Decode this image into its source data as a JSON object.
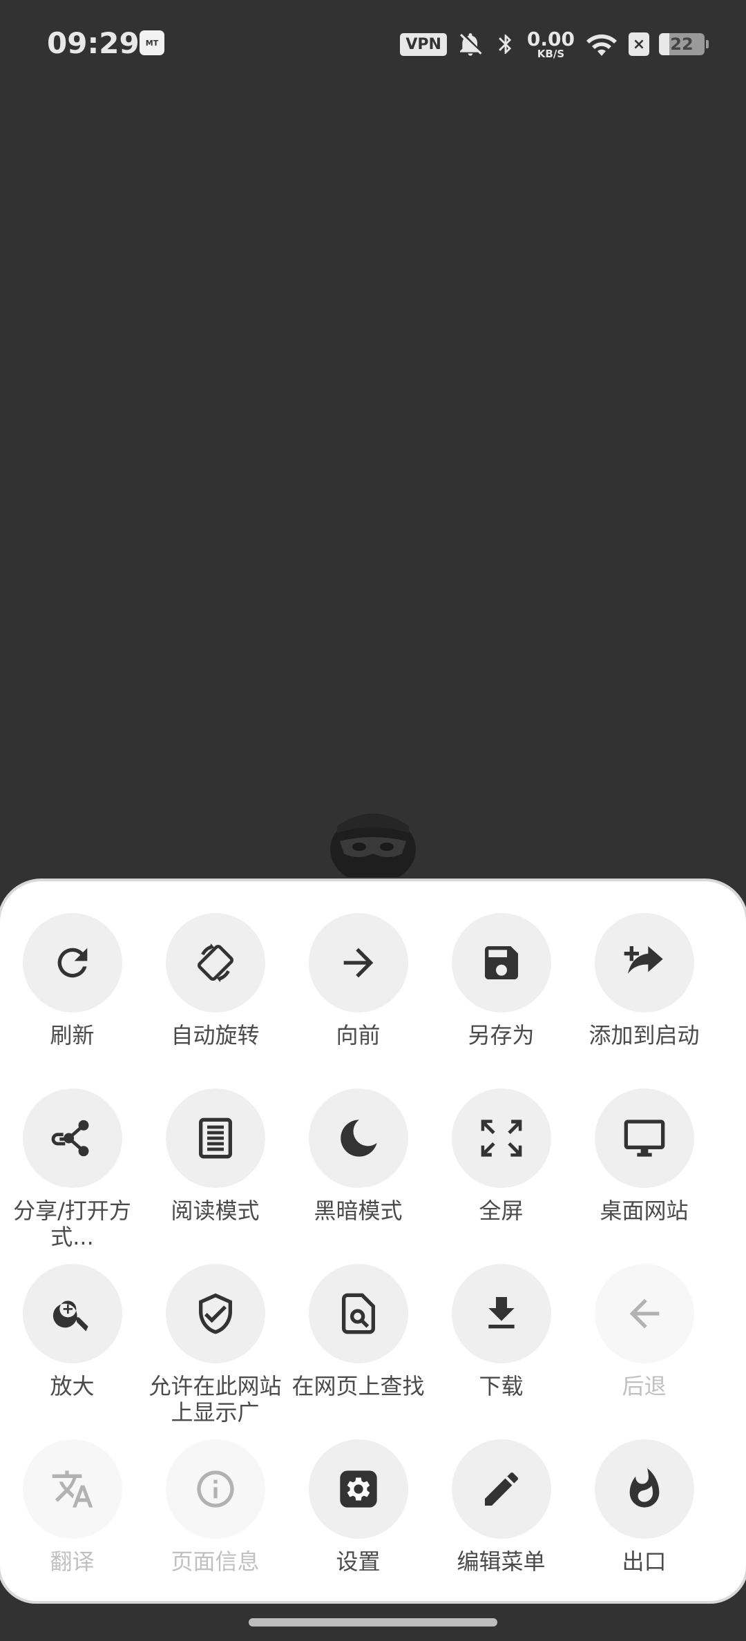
{
  "status_bar": {
    "time": "09:29",
    "notification_app_label": "MT",
    "vpn_label": "VPN",
    "net_speed_value": "0.00",
    "net_speed_unit": "KB/S",
    "battery_level": "22",
    "battery_fraction": 0.22,
    "icons": [
      "vpn-icon",
      "bell-off-icon",
      "bluetooth-icon",
      "wifi-icon",
      "sim-x-icon",
      "battery-icon"
    ]
  },
  "menu": {
    "rows": [
      [
        {
          "label": "刷新",
          "icon": "refresh-icon",
          "enabled": true
        },
        {
          "label": "自动旋转",
          "icon": "rotate-icon",
          "enabled": true
        },
        {
          "label": "向前",
          "icon": "forward-arrow-icon",
          "enabled": true
        },
        {
          "label": "另存为",
          "icon": "save-icon",
          "enabled": true
        },
        {
          "label": "添加到启动",
          "icon": "add-to-launcher-icon",
          "enabled": true
        }
      ],
      [
        {
          "label": "分享/打开方式...",
          "icon": "share-icon",
          "enabled": true
        },
        {
          "label": "阅读模式",
          "icon": "reader-mode-icon",
          "enabled": true
        },
        {
          "label": "黑暗模式",
          "icon": "moon-icon",
          "enabled": true
        },
        {
          "label": "全屏",
          "icon": "fullscreen-icon",
          "enabled": true
        },
        {
          "label": "桌面网站",
          "icon": "desktop-icon",
          "enabled": true
        }
      ],
      [
        {
          "label": "放大",
          "icon": "zoom-in-icon",
          "enabled": true
        },
        {
          "label": "允许在此网站上显示广",
          "icon": "shield-check-icon",
          "enabled": true
        },
        {
          "label": "在网页上查找",
          "icon": "find-in-page-icon",
          "enabled": true
        },
        {
          "label": "下载",
          "icon": "download-icon",
          "enabled": true
        },
        {
          "label": "后退",
          "icon": "back-arrow-icon",
          "enabled": false
        }
      ],
      [
        {
          "label": "翻译",
          "icon": "translate-icon",
          "enabled": false
        },
        {
          "label": "页面信息",
          "icon": "info-icon",
          "enabled": false
        },
        {
          "label": "设置",
          "icon": "gear-icon",
          "enabled": true
        },
        {
          "label": "编辑菜单",
          "icon": "pencil-icon",
          "enabled": true
        },
        {
          "label": "出口",
          "icon": "flame-icon",
          "enabled": true
        }
      ]
    ]
  }
}
